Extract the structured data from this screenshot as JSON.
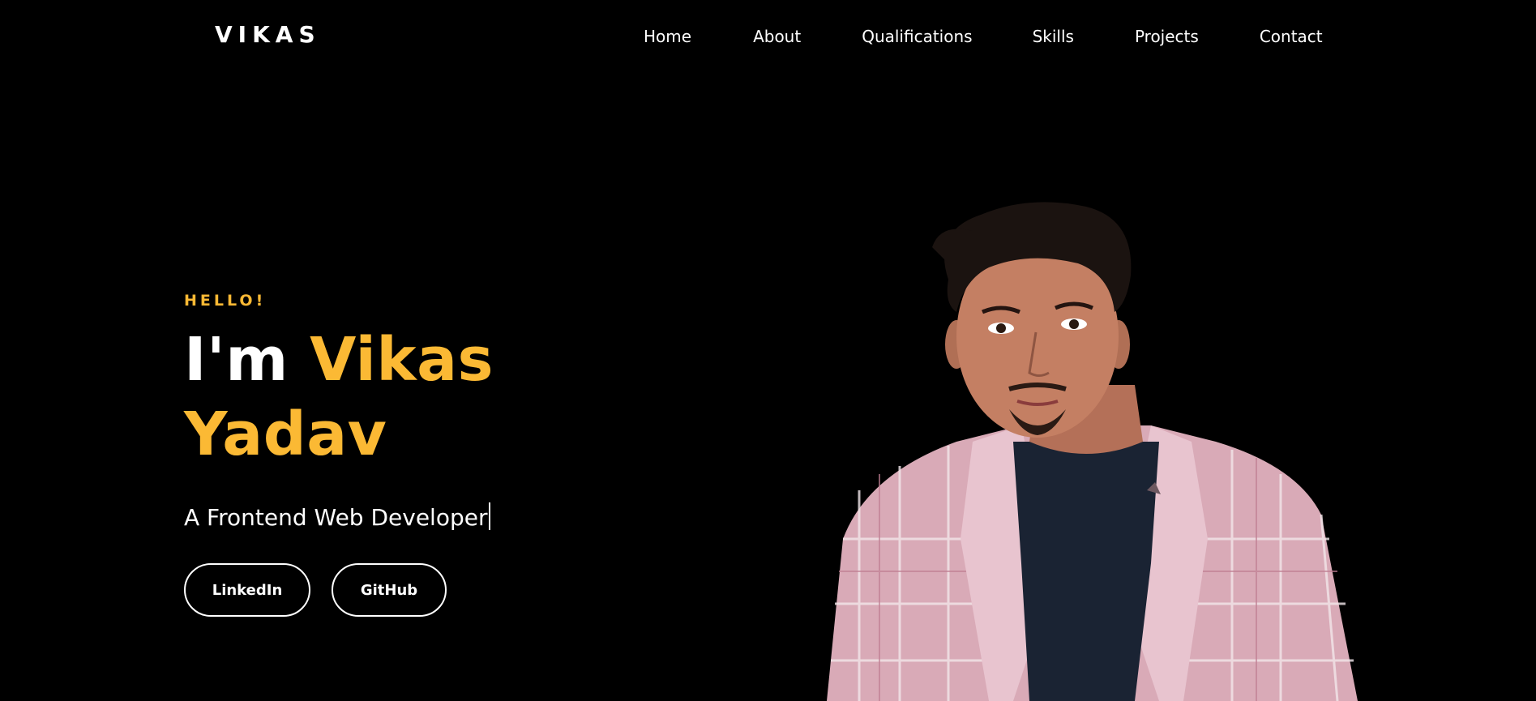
{
  "header": {
    "logo": "VIKAS",
    "nav": [
      "Home",
      "About",
      "Qualifications",
      "Skills",
      "Projects",
      "Contact"
    ]
  },
  "hero": {
    "greeting": "HELLO!",
    "name_prefix": "I'm",
    "name_first": "Vikas",
    "name_last": "Yadav",
    "subtitle": "A Frontend Web Developer",
    "buttons": {
      "linkedin": "LinkedIn",
      "github": "GitHub"
    }
  },
  "colors": {
    "background": "#000000",
    "accent": "#fbb934",
    "text": "#ffffff"
  },
  "icons": {
    "portrait": "profile-photo"
  }
}
